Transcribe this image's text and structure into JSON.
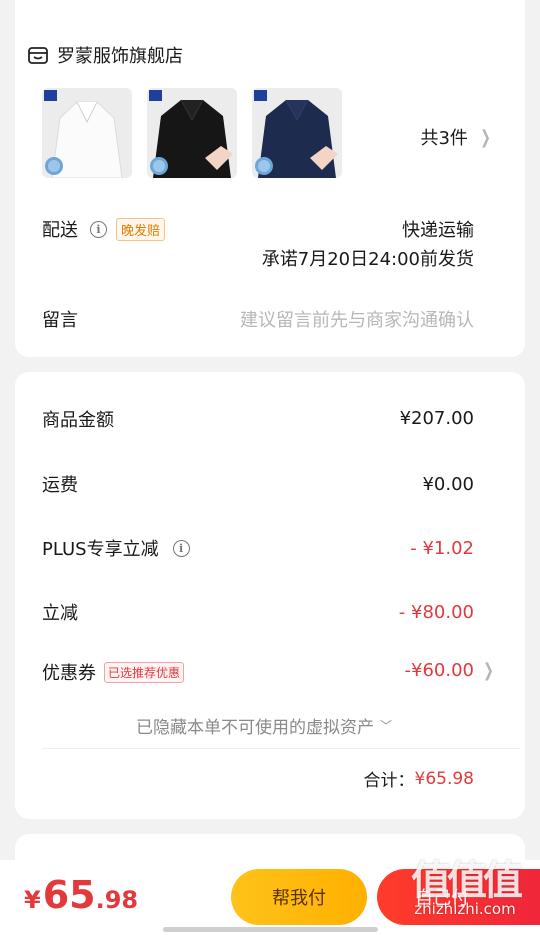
{
  "store": {
    "name": "罗蒙服饰旗舰店",
    "icon": "store-icon"
  },
  "products": {
    "items": [
      {
        "brand_badge": "罗蒙",
        "color": "#f4f4f4",
        "name": "white-polo"
      },
      {
        "brand_badge": "罗蒙",
        "color": "#161616",
        "name": "black-polo"
      },
      {
        "brand_badge": "罗蒙",
        "color": "#1d2b4f",
        "name": "navy-polo"
      }
    ],
    "count_label": "共3件"
  },
  "delivery": {
    "label": "配送",
    "tag": "晚发赔",
    "method": "快递运输",
    "promise": "承诺7月20日24:00前发货"
  },
  "message": {
    "label": "留言",
    "placeholder": "建议留言前先与商家沟通确认"
  },
  "summary": {
    "goods_label": "商品金额",
    "goods_value": "¥207.00",
    "shipping_label": "运费",
    "shipping_value": "¥0.00",
    "plus_label": "PLUS专享立减",
    "plus_value": "- ¥1.02",
    "discount_label": "立减",
    "discount_value": "- ¥80.00",
    "coupon_label": "优惠券",
    "coupon_tag": "已选推荐优惠",
    "coupon_value": "-¥60.00",
    "hidden_note": "已隐藏本单不可使用的虚拟资产",
    "total_label": "合计：",
    "total_value": "¥65.98"
  },
  "bottom": {
    "price_yen": "¥",
    "price_int": "65",
    "price_dec": ".98",
    "help_pay_label": "帮我付",
    "self_pay_label": "自己付"
  },
  "watermark": {
    "top": "值值值",
    "bottom": "zhizhizhi.com"
  },
  "colors": {
    "accent_red": "#e4393c",
    "button_yellow": "#ffb000",
    "button_red": "#f0263a"
  }
}
